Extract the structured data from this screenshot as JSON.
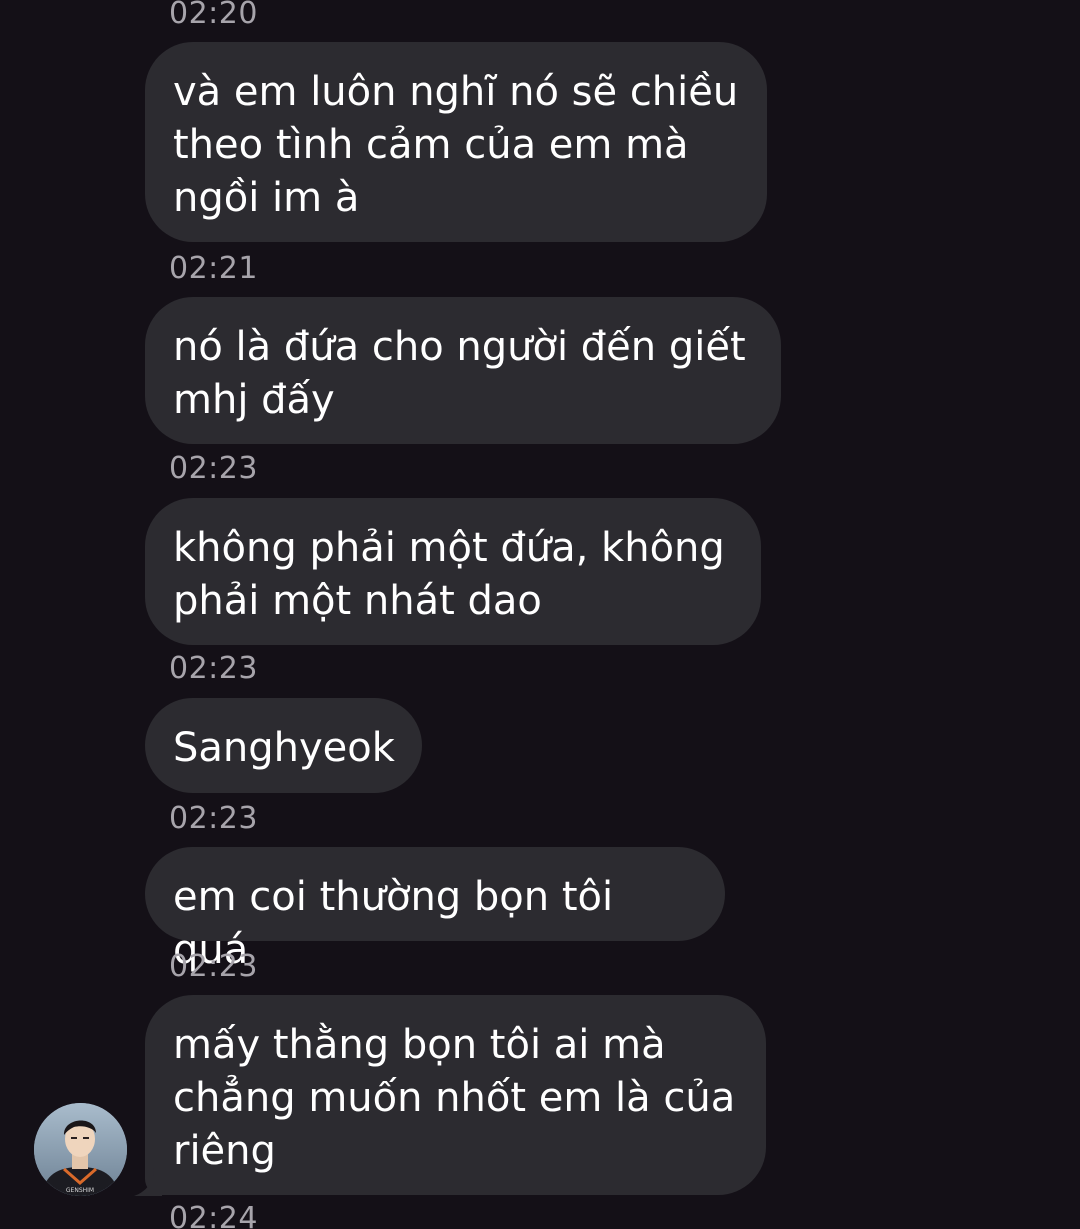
{
  "messages": [
    {
      "time": "02:20",
      "text": "và em luôn nghĩ nó sẽ chiều\ntheo tình cảm của em mà\nngồi im à"
    },
    {
      "time": "02:21",
      "text": "nó là đứa cho người đến giết\nmhj đấy"
    },
    {
      "time": "02:23",
      "text": "không phải một đứa, không\nphải một nhát dao"
    },
    {
      "time": "02:23",
      "text": "Sanghyeok"
    },
    {
      "time": "02:23",
      "text": "em coi thường bọn tôi quá"
    },
    {
      "time": "02:23",
      "text": "mấy thằng bọn tôi ai mà\nchẳng muốn nhốt em là của\nriêng"
    }
  ],
  "last_time": "02:24",
  "avatar": {
    "icon": "user-avatar-photo",
    "shirt_text": "GENSHIM"
  },
  "colors": {
    "background": "#141017",
    "bubble": "#2c2b30",
    "timestamp": "#a7a4ab",
    "text": "#ffffff"
  }
}
